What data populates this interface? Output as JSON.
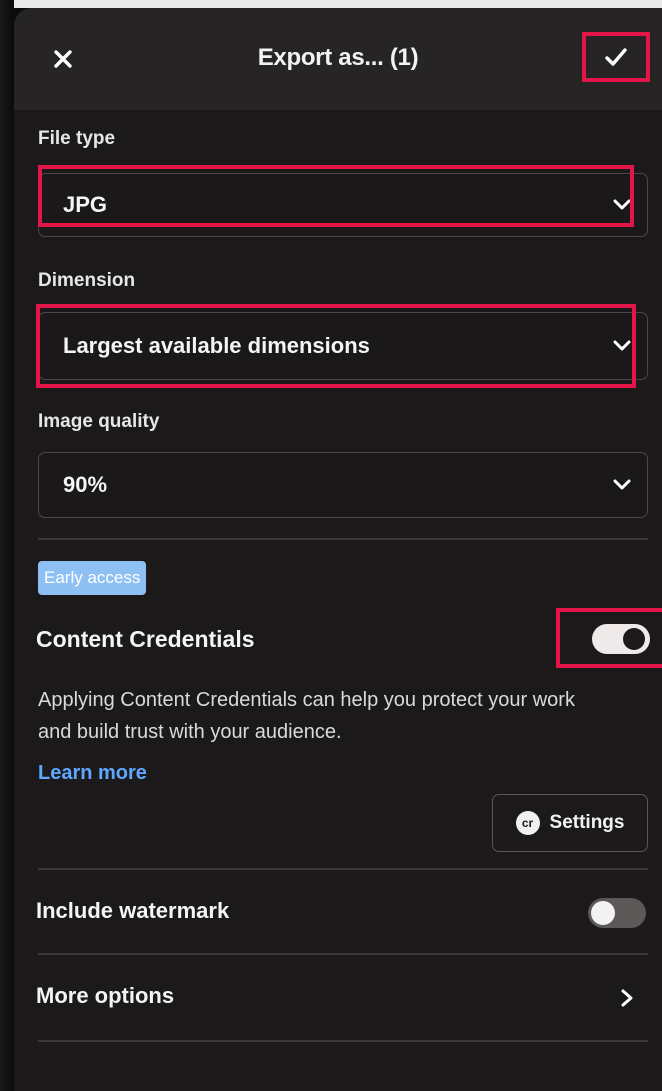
{
  "header": {
    "title": "Export as... (1)",
    "close_icon": "close-icon",
    "confirm_icon": "checkmark-icon"
  },
  "file_type": {
    "label": "File type",
    "value": "JPG"
  },
  "dimension": {
    "label": "Dimension",
    "value": "Largest available dimensions"
  },
  "image_quality": {
    "label": "Image quality",
    "value": "90%"
  },
  "content_credentials": {
    "badge": "Early access",
    "title": "Content Credentials",
    "enabled": true,
    "description": "Applying Content Credentials can help you protect your work and build trust with your audience.",
    "learn_more": "Learn more",
    "settings_icon_text": "cr",
    "settings_label": "Settings"
  },
  "watermark": {
    "label": "Include watermark",
    "enabled": false
  },
  "more_options": {
    "label": "More options"
  },
  "colors": {
    "highlight": "#e3164a",
    "accent_link": "#5ea7ff",
    "badge_bg": "#8ec0f4",
    "panel_bg": "#1b1919"
  }
}
